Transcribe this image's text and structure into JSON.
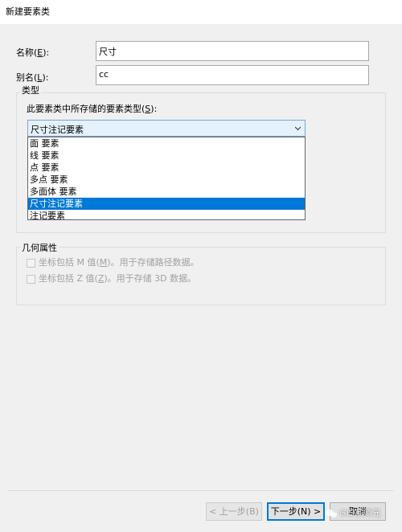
{
  "window": {
    "title": "新建要素类"
  },
  "name_field": {
    "label": "名称",
    "hotkey": "E",
    "value": "尺寸"
  },
  "alias_field": {
    "label": "别名",
    "hotkey": "L",
    "value": "cc"
  },
  "type_group": {
    "title": "类型",
    "prompt": "此要素类中所存储的要素类型",
    "prompt_hotkey": "S",
    "selected": "尺寸注记要素",
    "options": [
      "面 要素",
      "线 要素",
      "点 要素",
      "多点 要素",
      "多面体 要素",
      "尺寸注记要素",
      "注记要素"
    ],
    "selected_index": 5
  },
  "geometry_group": {
    "title": "几何属性",
    "m_option": {
      "prefix": "坐标包括 M 值(",
      "hotkey": "M",
      "suffix": ")。用于存储路径数据。",
      "checked": false,
      "enabled": false
    },
    "z_option": {
      "prefix": "坐标包括 Z 值(",
      "hotkey": "Z",
      "suffix": ")。用于存储 3D 数据。",
      "checked": false,
      "enabled": false
    }
  },
  "buttons": {
    "back": "< 上一步(B)",
    "next": "下一步(N) >",
    "cancel": "取消"
  },
  "watermark": "GIS宗师兄",
  "colors": {
    "accent": "#0078d7",
    "window_bg": "#f0f0f0"
  }
}
